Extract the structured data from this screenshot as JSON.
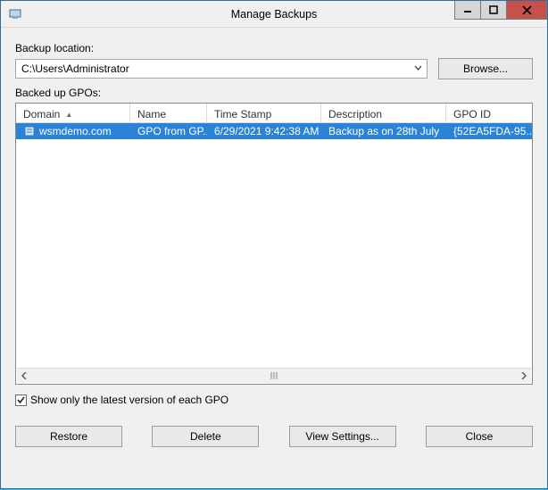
{
  "window": {
    "title": "Manage Backups"
  },
  "location": {
    "label": "Backup location:",
    "value": "C:\\Users\\Administrator",
    "browse_label": "Browse..."
  },
  "list": {
    "section_label": "Backed up GPOs:",
    "columns": {
      "domain": "Domain",
      "name": "Name",
      "time": "Time Stamp",
      "desc": "Description",
      "id": "GPO ID"
    },
    "rows": [
      {
        "domain": "wsmdemo.com",
        "name": "GPO from GP...",
        "time": "6/29/2021 9:42:38 AM",
        "desc": "Backup as on 28th July",
        "id": "{52EA5FDA-95..."
      }
    ]
  },
  "checkbox": {
    "label": "Show only the latest version of each GPO",
    "checked": true
  },
  "buttons": {
    "restore": "Restore",
    "delete": "Delete",
    "view_settings": "View Settings...",
    "close": "Close"
  }
}
